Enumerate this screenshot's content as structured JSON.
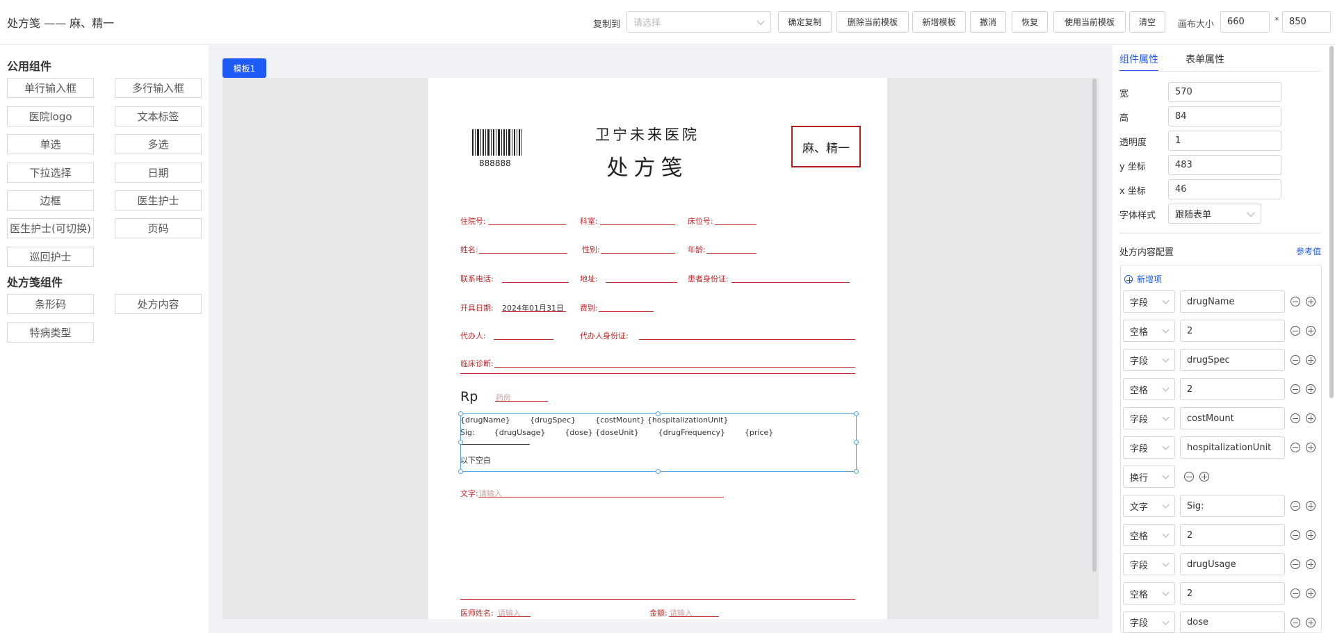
{
  "header": {
    "title": "处方笺 —— 麻、精一",
    "copy_to_label": "复制到",
    "copy_to_placeholder": "请选择",
    "buttons": {
      "confirm_copy": "确定复制",
      "delete_template": "删除当前模板",
      "add_template": "新增模板",
      "undo": "撤消",
      "redo": "恢复",
      "use_template": "使用当前模板",
      "clear": "清空"
    },
    "canvas_size_label": "画布大小",
    "canvas_width": "660",
    "times": "*",
    "canvas_height": "850"
  },
  "left": {
    "public_title": "公用组件",
    "public_items": [
      "单行输入框",
      "多行输入框",
      "医院logo",
      "文本标签",
      "单选",
      "多选",
      "下拉选择",
      "日期",
      "边框",
      "医生护士",
      "医生护士(可切换)",
      "页码",
      "巡回护士"
    ],
    "rx_title": "处方笺组件",
    "rx_items": [
      "条形码",
      "处方内容",
      "特病类型"
    ]
  },
  "center": {
    "tab": "模板1",
    "paper": {
      "barcode_number": "888888",
      "hospital": "卫宁未来医院",
      "title": "处方笺",
      "stamp": "麻、精一",
      "fields": {
        "inpatient_no": "住院号:",
        "department": "科室:",
        "bed_no": "床位号:",
        "name": "姓名:",
        "gender": "性别:",
        "age": "年龄:",
        "phone": "联系电话:",
        "address": "地址:",
        "patient_id": "患者身份证:",
        "issue_date": "开具日期:",
        "issue_date_value": "2024年01月31日",
        "fee_type": "费别:",
        "agent": "代办人:",
        "agent_id": "代办人身份证:",
        "diagnosis": "临床诊断:"
      },
      "rp": "Rp",
      "pharmacy_placeholder": "药房",
      "content_line1": "{drugName}        {drugSpec}        {costMount} {hospitalizationUnit}",
      "content_line2": "Sig:        {drugUsage}        {dose} {doseUnit}        {drugFrequency}        {price}",
      "below_blank": "以下空白",
      "text_label": "文字:",
      "text_placeholder": "请输入",
      "doctor_label": "医师姓名:",
      "doctor_placeholder": "请输入",
      "amount_label": "金额:",
      "amount_placeholder": "请输入"
    }
  },
  "right": {
    "tabs": [
      "组件属性",
      "表单属性"
    ],
    "props": [
      {
        "label": "宽",
        "value": "570"
      },
      {
        "label": "高",
        "value": "84"
      },
      {
        "label": "透明度",
        "value": "1"
      },
      {
        "label": "y 坐标",
        "value": "483"
      },
      {
        "label": "x 坐标",
        "value": "46"
      }
    ],
    "font_style_label": "字体样式",
    "font_style_value": "跟随表单",
    "config_title": "处方内容配置",
    "reference_link": "参考值",
    "add_item": "新增项",
    "rows": [
      {
        "type": "字段",
        "value": "drugName"
      },
      {
        "type": "空格",
        "value": "2"
      },
      {
        "type": "字段",
        "value": "drugSpec"
      },
      {
        "type": "空格",
        "value": "2"
      },
      {
        "type": "字段",
        "value": "costMount"
      },
      {
        "type": "字段",
        "value": "hospitalizationUnit"
      },
      {
        "type": "换行",
        "value": ""
      },
      {
        "type": "文字",
        "value": "Sig:"
      },
      {
        "type": "空格",
        "value": "2"
      },
      {
        "type": "字段",
        "value": "drugUsage"
      },
      {
        "type": "空格",
        "value": "2"
      },
      {
        "type": "字段",
        "value": "dose"
      }
    ]
  },
  "colors": {
    "accent": "#1e5bf6",
    "form_red": "#c62828",
    "selection": "#4ea8e8"
  }
}
